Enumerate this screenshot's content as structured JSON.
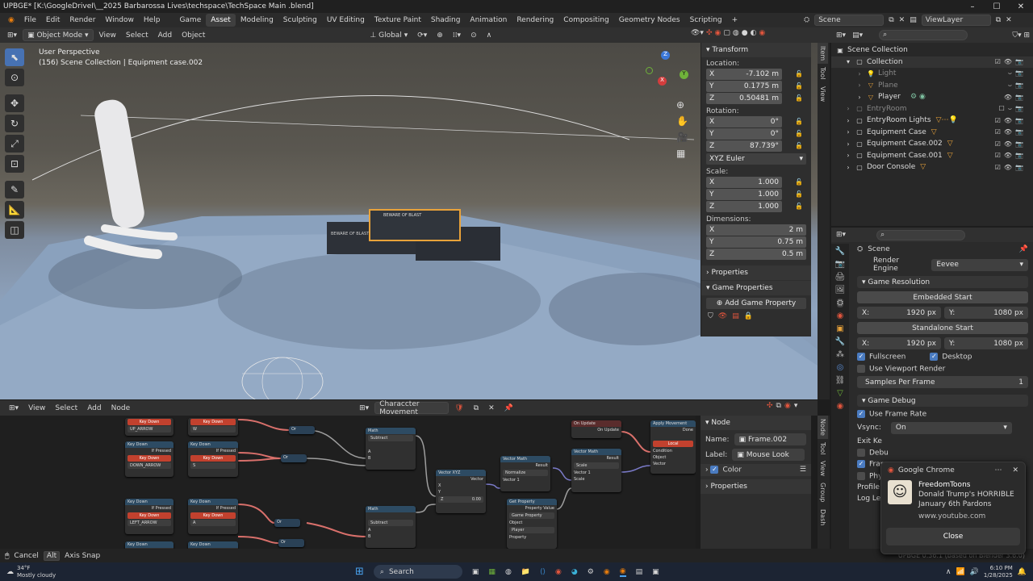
{
  "window": {
    "title": "UPBGE* [K:\\GoogleDriveI\\__2025 Barbarossa Lives\\techspace\\TechSpace Main .blend]"
  },
  "menubar": {
    "menus": [
      "File",
      "Edit",
      "Render",
      "Window",
      "Help"
    ],
    "workspaces": [
      "Game",
      "Asset",
      "Modeling",
      "Sculpting",
      "UV Editing",
      "Texture Paint",
      "Shading",
      "Animation",
      "Rendering",
      "Compositing",
      "Geometry Nodes",
      "Scripting"
    ],
    "active_workspace": "Asset",
    "add_tab": "+",
    "scene": "Scene",
    "view_layer": "ViewLayer"
  },
  "viewport_header": {
    "mode": "Object Mode",
    "menus": [
      "View",
      "Select",
      "Add",
      "Object"
    ],
    "orientation": "Global"
  },
  "viewport": {
    "info_line1": "User Perspective",
    "info_line2": "(156) Scene Collection | Equipment case.002",
    "gizmo": {
      "x": "X",
      "y": "Y",
      "z": "Z"
    },
    "crate_label": "BEWARE OF BLAST"
  },
  "n_panel": {
    "transform_title": "Transform",
    "location_label": "Location:",
    "location": [
      {
        "axis": "X",
        "value": "-7.102 m"
      },
      {
        "axis": "Y",
        "value": "0.1775 m"
      },
      {
        "axis": "Z",
        "value": "0.50481 m"
      }
    ],
    "rotation_label": "Rotation:",
    "rotation": [
      {
        "axis": "X",
        "value": "0°"
      },
      {
        "axis": "Y",
        "value": "0°"
      },
      {
        "axis": "Z",
        "value": "87.739°"
      }
    ],
    "rotation_mode": "XYZ Euler",
    "scale_label": "Scale:",
    "scale": [
      {
        "axis": "X",
        "value": "1.000"
      },
      {
        "axis": "Y",
        "value": "1.000"
      },
      {
        "axis": "Z",
        "value": "1.000"
      }
    ],
    "dimensions_label": "Dimensions:",
    "dimensions": [
      {
        "axis": "X",
        "value": "2 m"
      },
      {
        "axis": "Y",
        "value": "0.75 m"
      },
      {
        "axis": "Z",
        "value": "0.5 m"
      }
    ],
    "properties_title": "Properties",
    "game_properties_title": "Game Properties",
    "add_game_property": "Add Game Property",
    "tabs": [
      "Item",
      "Tool",
      "View"
    ]
  },
  "outliner": {
    "root": "Scene Collection",
    "rows": [
      {
        "name": "Collection",
        "indent": 1
      },
      {
        "name": "Light",
        "indent": 2,
        "dim": true
      },
      {
        "name": "Plane",
        "indent": 2,
        "dim": true
      },
      {
        "name": "Player",
        "indent": 2
      },
      {
        "name": "EntryRoom",
        "indent": 1,
        "dim": true
      },
      {
        "name": "EntryRoom Lights",
        "indent": 1
      },
      {
        "name": "Equipment Case",
        "indent": 1
      },
      {
        "name": "Equipment Case.002",
        "indent": 1
      },
      {
        "name": "Equipment Case.001",
        "indent": 1
      },
      {
        "name": "Door Console",
        "indent": 1
      }
    ]
  },
  "properties": {
    "scene": "Scene",
    "render_engine_label": "Render Engine",
    "render_engine": "Eevee",
    "game_resolution_title": "Game Resolution",
    "embedded_start": "Embedded Start",
    "standalone_start": "Standalone Start",
    "x_label": "X:",
    "y_label": "Y:",
    "res_x": "1920 px",
    "res_y": "1080 px",
    "fullscreen": "Fullscreen",
    "desktop": "Desktop",
    "use_viewport_render": "Use Viewport Render",
    "samples_label": "Samples Per Frame",
    "samples_value": "1",
    "game_debug_title": "Game Debug",
    "use_frame_rate": "Use Frame Rate",
    "vsync_label": "Vsync:",
    "vsync_value": "On",
    "exit_key": "Exit Ke",
    "debug": "Debu",
    "frame": "Fram",
    "physics": "Phys",
    "profile": "Profile S",
    "log_level": "Log Lev"
  },
  "node_editor": {
    "menus": [
      "View",
      "Select",
      "Add",
      "Node"
    ],
    "tree_name": "Characcter Movement",
    "nodes": {
      "key_down": "Key Down",
      "if_pressed": "If Pressed",
      "up_arrow": "UP_ARROW",
      "down_arrow": "DOWN_ARROW",
      "left_arrow": "LEFT_ARROW",
      "w": "W",
      "s": "S",
      "a": "A",
      "or": "Or",
      "math": "Math",
      "subtract": "Subtract",
      "a_in": "A",
      "b_in": "B",
      "vector_xyz": "Vector XYZ",
      "vector": "Vector",
      "x": "X",
      "y": "Y",
      "z": "Z",
      "z_val": "0.00",
      "vector_math": "Vector Math",
      "result": "Result",
      "normalize": "Normalize",
      "vector1": "Vector 1",
      "scale_op": "Scale",
      "scale": "Scale",
      "get_property": "Get Property",
      "property_value": "Property Value",
      "game_property": "Game Property",
      "object": "Object",
      "player": "Player",
      "property": "Property",
      "on_update": "On Update",
      "apply_movement": "Apply Movement",
      "done": "Done",
      "local": "Local",
      "condition": "Condition",
      "movement_vector": "Vector"
    }
  },
  "node_npanel": {
    "node_title": "Node",
    "name_label": "Name:",
    "name_value": "Frame.002",
    "label_label": "Label:",
    "label_value": "Mouse Look",
    "color": "Color",
    "properties": "Properties",
    "tabs": [
      "Node",
      "Tool",
      "View",
      "Group",
      "Dash"
    ]
  },
  "statusbar": {
    "cancel": "Cancel",
    "alt": "Alt",
    "axis_snap": "Axis Snap",
    "version": "UPBGE 0.36.1 (based on Blender 3.6.0)"
  },
  "taskbar": {
    "weather_temp": "34°F",
    "weather_text": "Mostly cloudy",
    "search": "Search",
    "time": "6:10 PM",
    "date": "1/28/2025"
  },
  "toast": {
    "app": "Google Chrome",
    "title": "FreedomToons",
    "line1": "Donald Trump's HORRIBLE",
    "line2": "January 6th Pardons",
    "site": "www.youtube.com",
    "close": "Close"
  },
  "colors": {
    "accent": "#4772b3",
    "selection": "#e8a23a",
    "node_red": "#c2412e"
  }
}
